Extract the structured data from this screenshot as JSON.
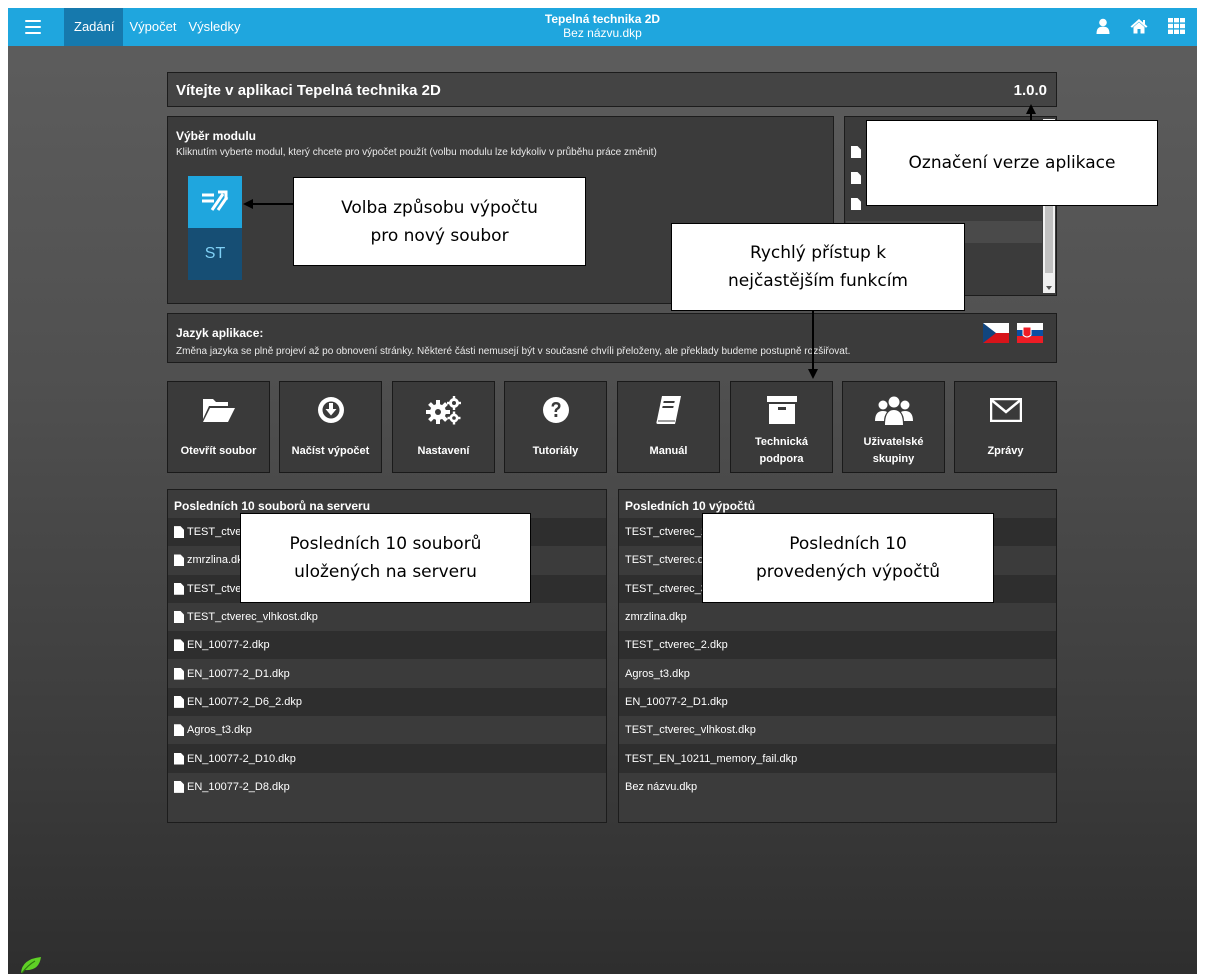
{
  "topbar": {
    "tabs": [
      "Zadání",
      "Výpočet",
      "Výsledky"
    ],
    "title": "Tepelná technika 2D",
    "subtitle": "Bez názvu.dkp",
    "icons": [
      "user-icon",
      "home-icon",
      "apps-grid-icon"
    ]
  },
  "welcome": {
    "title": "Vítejte v aplikaci Tepelná technika 2D",
    "version": "1.0.0"
  },
  "module": {
    "title": "Výběr modulu",
    "subtitle": "Kliknutím vyberte modul, který chcete pro výpočet použít (volbu modulu lze kdykoliv v průběhu práce změnit)",
    "btn_st": "ST"
  },
  "language": {
    "title": "Jazyk aplikace:",
    "subtitle": "Změna jazyka se plně projeví až po obnovení stránky. Některé části nemusejí být v současné chvíli přeloženy, ale překlady budeme postupně rozšiřovat."
  },
  "tiles": [
    {
      "label": "Otevřít soubor",
      "icon": "folder-open-icon"
    },
    {
      "label": "Načíst výpočet",
      "icon": "download-circle-icon"
    },
    {
      "label": "Nastavení",
      "icon": "gears-icon"
    },
    {
      "label": "Tutoriály",
      "icon": "question-icon"
    },
    {
      "label": "Manuál",
      "icon": "book-icon"
    },
    {
      "label": "Technická podpora",
      "icon": "archive-icon"
    },
    {
      "label": "Uživatelské skupiny",
      "icon": "users-icon"
    },
    {
      "label": "Zprávy",
      "icon": "envelope-icon"
    }
  ],
  "server_files": {
    "title": "Posledních 10 souborů na serveru",
    "items": [
      "TEST_ctverec_1.dkp",
      "zmrzlina.dkp",
      "TEST_ctverec_2.dkp",
      "TEST_ctverec_vlhkost.dkp",
      "EN_10077-2.dkp",
      "EN_10077-2_D1.dkp",
      "EN_10077-2_D6_2.dkp",
      "Agros_t3.dkp",
      "EN_10077-2_D10.dkp",
      "EN_10077-2_D8.dkp"
    ]
  },
  "recent_calcs": {
    "title": "Posledních 10 výpočtů",
    "items": [
      "TEST_ctverec_1.dkp",
      "TEST_ctverec.dkp",
      "TEST_ctverec_3.dkp",
      "zmrzlina.dkp",
      "TEST_ctverec_2.dkp",
      "Agros_t3.dkp",
      "EN_10077-2_D1.dkp",
      "TEST_ctverec_vlhkost.dkp",
      "TEST_EN_10211_memory_fail.dkp",
      "Bez názvu.dkp"
    ]
  },
  "callouts": {
    "version": "Označení verze aplikace",
    "module_line1": "Volba způsobu výpočtu",
    "module_line2": "pro nový soubor",
    "quick_line1": "Rychlý přístup k",
    "quick_line2": "nejčastějším funkcím",
    "server_line1": "Posledních 10 souborů",
    "server_line2": "uložených na serveru",
    "calcs_line1": "Posledních 10",
    "calcs_line2": "provedených výpočtů"
  },
  "colors": {
    "topbar": "#1fa6de",
    "active_tab": "#1679ad",
    "module_a": "#1fa6de",
    "module_b": "#164e74"
  }
}
